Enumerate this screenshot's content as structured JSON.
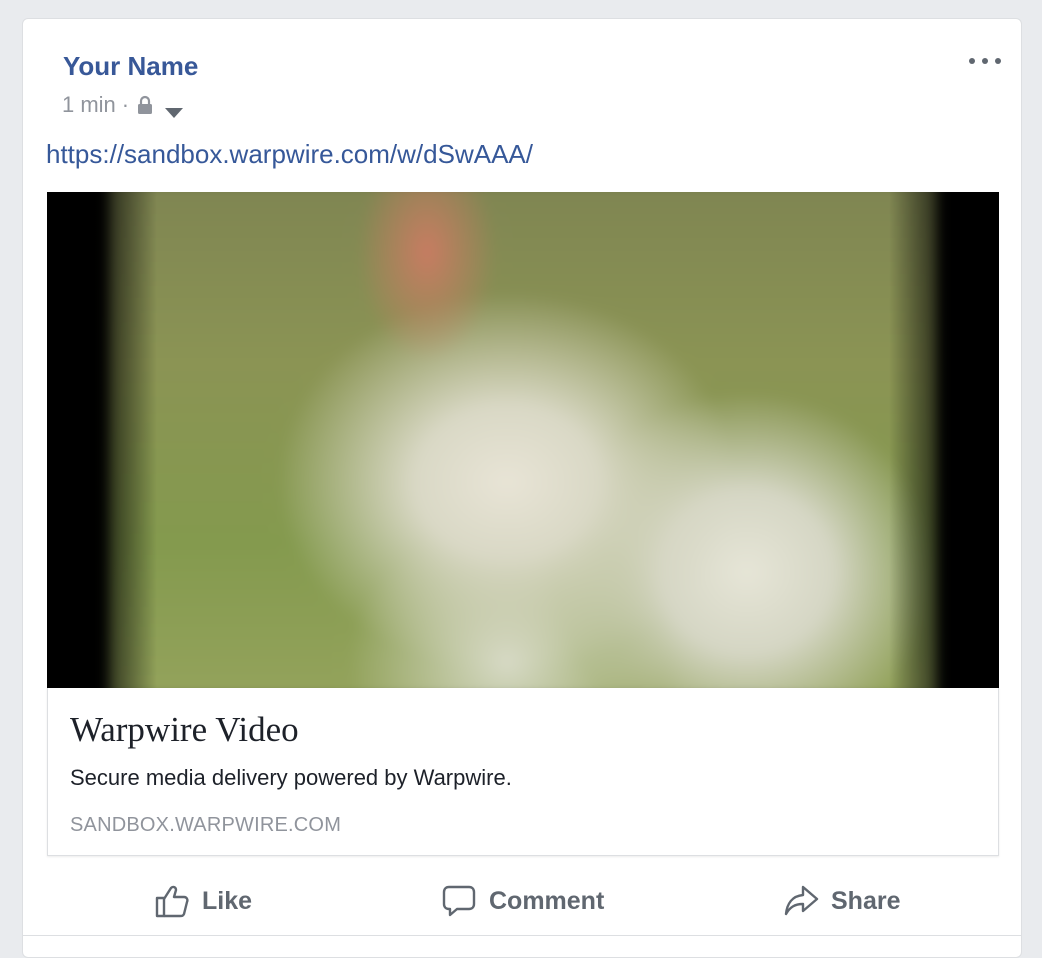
{
  "post": {
    "author": "Your Name",
    "time": "1 min",
    "separator": "·",
    "privacy_icon": "lock-icon",
    "audience_icon": "caret-down-icon",
    "more_icon": "ellipsis-icon",
    "link_text": "https://sandbox.warpwire.com/w/dSwAAA/"
  },
  "link_preview": {
    "title": "Warpwire Video",
    "description": "Secure media delivery powered by Warpwire.",
    "domain": "SANDBOX.WARPWIRE.COM"
  },
  "actions": [
    {
      "label": "Like",
      "icon": "thumbs-up-icon"
    },
    {
      "label": "Comment",
      "icon": "speech-bubble-icon"
    },
    {
      "label": "Share",
      "icon": "share-arrow-icon"
    }
  ],
  "colors": {
    "author": "#385898",
    "link": "#365899",
    "meta": "#90949c",
    "action": "#606770",
    "background": "#e9ebee"
  }
}
